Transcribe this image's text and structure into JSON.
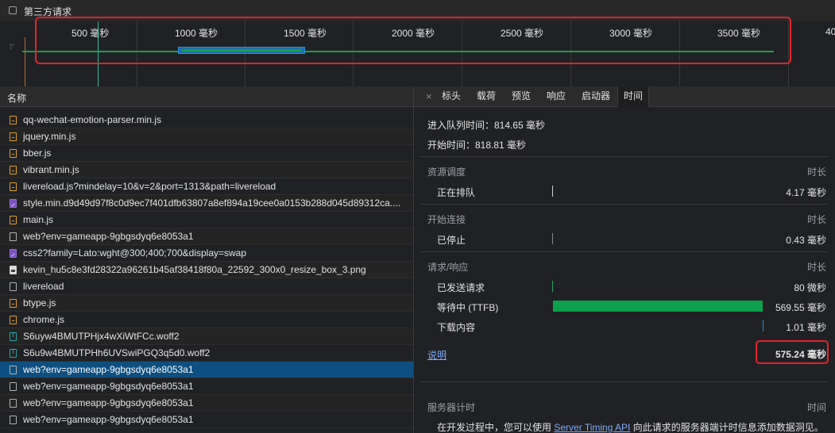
{
  "filter": {
    "third_party_label": "第三方请求"
  },
  "overview": {
    "ticks": [
      "500 毫秒",
      "1000 毫秒",
      "1500 毫秒",
      "2000 毫秒",
      "2500 毫秒",
      "3000 毫秒",
      "3500 毫秒",
      "40"
    ]
  },
  "requests": {
    "header": "名称",
    "rows": [
      {
        "name": "qq-wechat-emotion-parser.min.js",
        "type": "js"
      },
      {
        "name": "jquery.min.js",
        "type": "js"
      },
      {
        "name": "bber.js",
        "type": "js"
      },
      {
        "name": "vibrant.min.js",
        "type": "js"
      },
      {
        "name": "livereload.js?mindelay=10&v=2&port=1313&path=livereload",
        "type": "js"
      },
      {
        "name": "style.min.d9d49d97f8c0d9ec7f401dfb63807a8ef894a19cee0a0153b288d045d89312ca....",
        "type": "css"
      },
      {
        "name": "main.js",
        "type": "js"
      },
      {
        "name": "web?env=gameapp-9gbgsdyq6e8053a1",
        "type": "doc"
      },
      {
        "name": "css2?family=Lato:wght@300;400;700&display=swap",
        "type": "css"
      },
      {
        "name": "kevin_hu5c8e3fd28322a96261b45af38418f80a_22592_300x0_resize_box_3.png",
        "type": "img"
      },
      {
        "name": "livereload",
        "type": "doc"
      },
      {
        "name": "btype.js",
        "type": "js"
      },
      {
        "name": "chrome.js",
        "type": "js"
      },
      {
        "name": "S6uyw4BMUTPHjx4wXiWtFCc.woff2",
        "type": "font"
      },
      {
        "name": "S6u9w4BMUTPHh6UVSwiPGQ3q5d0.woff2",
        "type": "font"
      },
      {
        "name": "web?env=gameapp-9gbgsdyq6e8053a1",
        "type": "doc",
        "selected": true
      },
      {
        "name": "web?env=gameapp-9gbgsdyq6e8053a1",
        "type": "doc"
      },
      {
        "name": "web?env=gameapp-9gbgsdyq6e8053a1",
        "type": "doc"
      },
      {
        "name": "web?env=gameapp-9gbgsdyq6e8053a1",
        "type": "doc"
      }
    ]
  },
  "tabs": {
    "close": "×",
    "headers": "标头",
    "payload": "载荷",
    "preview": "预览",
    "response": "响应",
    "initiator": "启动器",
    "timing": "时间"
  },
  "timing": {
    "queued_at": "进入队列时间：814.65 毫秒",
    "started_at": "开始时间：818.81 毫秒",
    "resource_scheduling": {
      "title": "资源调度",
      "duration_header": "时长",
      "queueing_label": "正在排队",
      "queueing_value": "4.17 毫秒"
    },
    "connection_start": {
      "title": "开始连接",
      "duration_header": "时长",
      "stalled_label": "已停止",
      "stalled_value": "0.43 毫秒"
    },
    "request_response": {
      "title": "请求/响应",
      "duration_header": "时长",
      "sent_label": "已发送请求",
      "sent_value": "80 微秒",
      "waiting_label": "等待中 (TTFB)",
      "waiting_value": "569.55 毫秒",
      "download_label": "下载内容",
      "download_value": "1.01 毫秒"
    },
    "explanation_link": "说明",
    "total": "575.24 毫秒",
    "server_timing": {
      "title": "服务器计时",
      "time_header": "时间",
      "desc_before": "在开发过程中，您可以使用",
      "desc_link": "Server Timing API",
      "desc_after": "向此请求的服务器端计时信息添加数据洞见。"
    },
    "colors": {
      "waiting_bar": "#0ca04a",
      "highlight": "#e0242a"
    }
  }
}
